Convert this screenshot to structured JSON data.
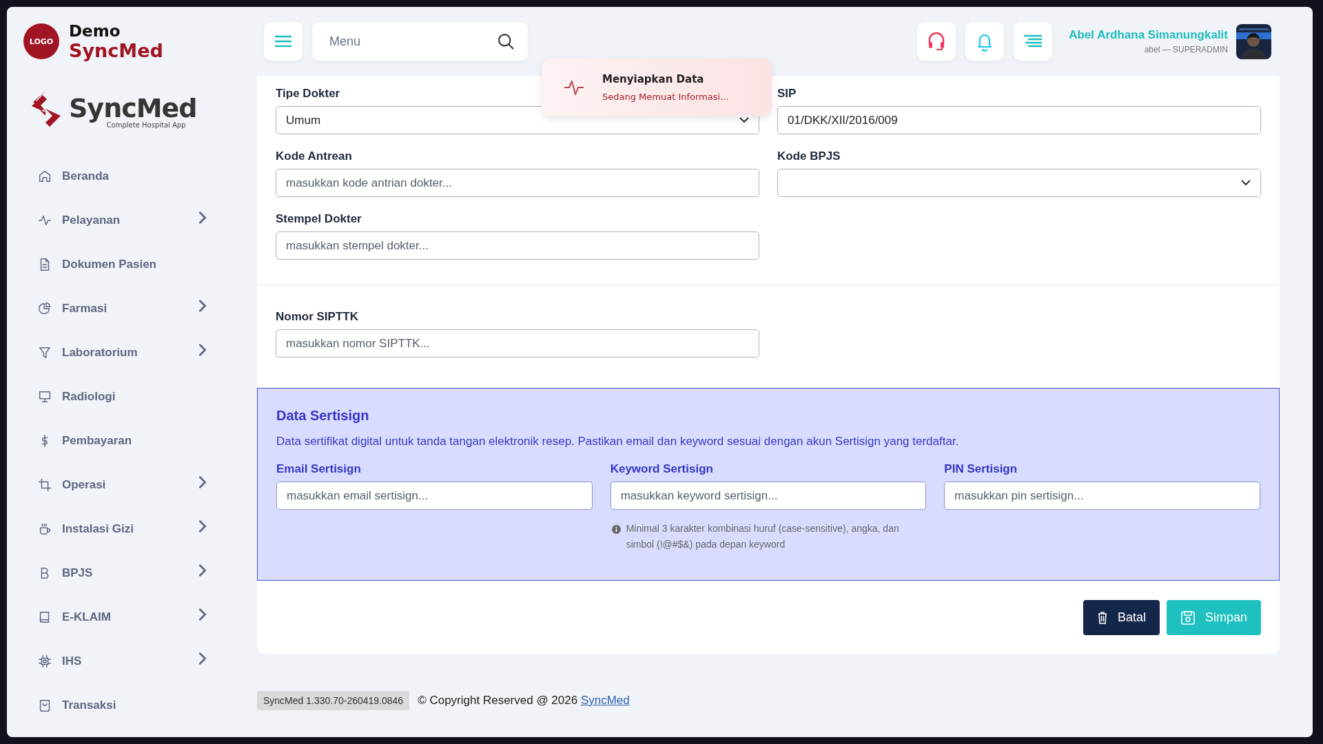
{
  "brand": {
    "badge": "LOGO",
    "line1": "Demo",
    "line2": "SyncMed"
  },
  "sidebar_logo": {
    "name": "SyncMed",
    "tagline": "Complete Hospital App"
  },
  "sidebar": {
    "items": [
      {
        "label": "Beranda",
        "kind": "home",
        "submenu": false
      },
      {
        "label": "Pelayanan",
        "kind": "pulse",
        "submenu": true
      },
      {
        "label": "Dokumen Pasien",
        "kind": "document",
        "submenu": false
      },
      {
        "label": "Farmasi",
        "kind": "pie",
        "submenu": true
      },
      {
        "label": "Laboratorium",
        "kind": "filter",
        "submenu": true
      },
      {
        "label": "Radiologi",
        "kind": "monitor",
        "submenu": false
      },
      {
        "label": "Pembayaran",
        "kind": "dollar",
        "submenu": false
      },
      {
        "label": "Operasi",
        "kind": "crop",
        "submenu": true
      },
      {
        "label": "Instalasi Gizi",
        "kind": "cup",
        "submenu": true
      },
      {
        "label": "BPJS",
        "kind": "letter",
        "submenu": true
      },
      {
        "label": "E-KLAIM",
        "kind": "book",
        "submenu": true
      },
      {
        "label": "IHS",
        "kind": "chip",
        "submenu": true
      },
      {
        "label": "Transaksi",
        "kind": "bag",
        "submenu": false
      }
    ]
  },
  "topbar": {
    "search": {
      "placeholder": "Menu"
    },
    "user": {
      "name": "Abel Ardhana Simanungkalit",
      "subtitle": "abel — SUPERADMIN"
    }
  },
  "toast": {
    "title": "Menyiapkan Data",
    "message": "Sedang Memuat Informasi..."
  },
  "form": {
    "sections": [
      {
        "fields": [
          {
            "label": "Tipe Dokter",
            "kind": "select",
            "value": "Umum"
          },
          {
            "label": "SIP",
            "kind": "input",
            "value": "01/DKK/XII/2016/009"
          },
          {
            "label": "Kode Antrean",
            "kind": "input",
            "placeholder": "masukkan kode antrian dokter..."
          },
          {
            "label": "Kode BPJS",
            "kind": "select"
          },
          {
            "label": "Stempel Dokter",
            "kind": "input",
            "placeholder": "masukkan stempel dokter..."
          }
        ]
      },
      {
        "fields": [
          {
            "label": "Nomor SIPTTK",
            "kind": "input",
            "placeholder": "masukkan nomor SIPTTK..."
          }
        ]
      }
    ]
  },
  "sertisign": {
    "title": "Data Sertisign",
    "description": "Data sertifikat digital untuk tanda tangan elektronik resep. Pastikan email dan keyword sesuai dengan akun Sertisign yang terdaftar.",
    "fields": [
      {
        "label": "Email Sertisign",
        "placeholder": "masukkan email sertisign..."
      },
      {
        "label": "Keyword Sertisign",
        "placeholder": "masukkan keyword sertisign...",
        "hint": "Minimal 3 karakter kombinasi huruf (case-sensitive), angka, dan simbol (!@#$&) pada depan keyword"
      },
      {
        "label": "PIN Sertisign",
        "placeholder": "masukkan pin sertisign..."
      }
    ]
  },
  "actions": [
    {
      "label": "Batal",
      "kind": "cancel"
    },
    {
      "label": "Simpan",
      "kind": "save"
    }
  ],
  "footer": {
    "version": "SyncMed 1.330.70-260419.0846",
    "copyright": "© Copyright Reserved @ 2026",
    "link": "SyncMed"
  }
}
